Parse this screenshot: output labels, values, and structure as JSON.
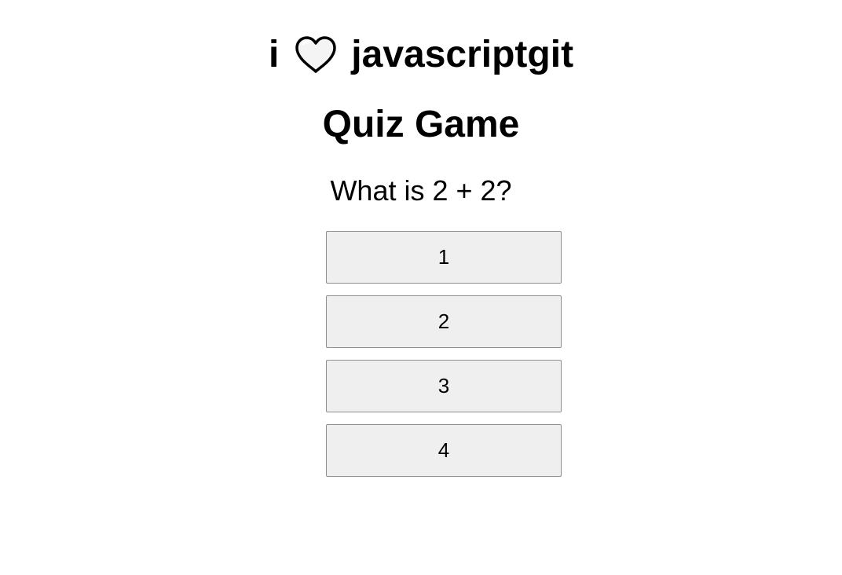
{
  "header": {
    "brand_prefix": "i",
    "brand_icon": "heart-icon",
    "brand_suffix": "javascriptgit"
  },
  "quiz": {
    "title": "Quiz Game",
    "question": "What is 2 + 2?",
    "answers": [
      "1",
      "2",
      "3",
      "4"
    ]
  },
  "colors": {
    "button_bg": "#efefef",
    "button_border": "#8f8f8f",
    "text": "#000000"
  }
}
